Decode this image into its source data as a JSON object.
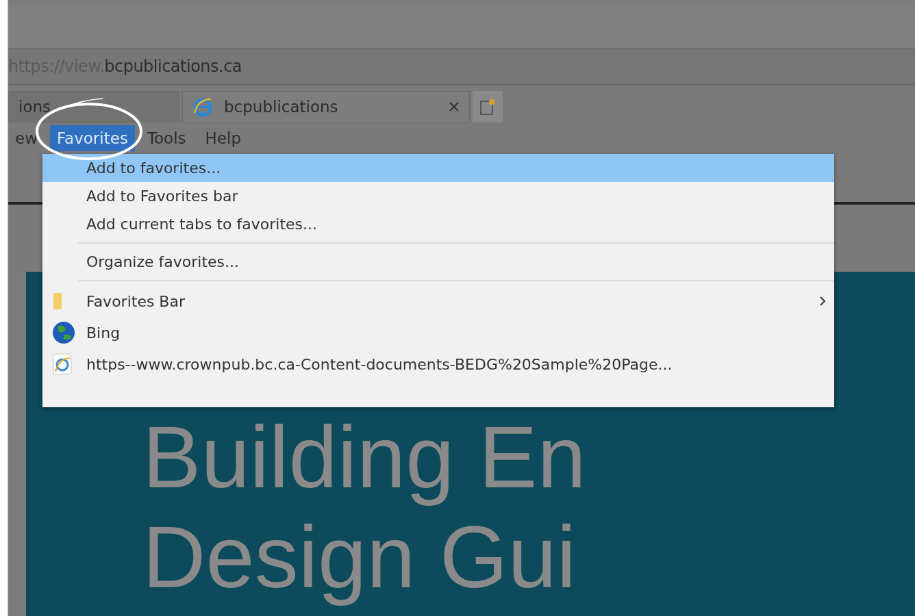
{
  "address_bar": {
    "url_prefix": "https://view.",
    "url_domain": "bcpublications.ca"
  },
  "tabs": [
    {
      "label": "ions",
      "selected": false,
      "closable": false
    },
    {
      "label": "bcpublications",
      "selected": true,
      "closable": true
    }
  ],
  "menu_bar": [
    {
      "label": "ew",
      "selected": false
    },
    {
      "label": "Favorites",
      "selected": true
    },
    {
      "label": "Tools",
      "selected": false
    },
    {
      "label": "Help",
      "selected": false
    }
  ],
  "favorites_menu": [
    {
      "kind": "command",
      "label": "Add to favorites...",
      "selected": true
    },
    {
      "kind": "command",
      "label": "Add to Favorites bar",
      "selected": false
    },
    {
      "kind": "command",
      "label": "Add current tabs to favorites...",
      "selected": false
    },
    {
      "kind": "separator"
    },
    {
      "kind": "command",
      "label": "Organize favorites...",
      "selected": false
    },
    {
      "kind": "separator"
    },
    {
      "kind": "folder",
      "label": "Favorites Bar",
      "selected": false
    },
    {
      "kind": "engine",
      "label": "Bing",
      "selected": false
    },
    {
      "kind": "link",
      "label": "https--www.crownpub.bc.ca-Content-documents-BEDG%20Sample%20Page...",
      "selected": false
    }
  ],
  "page": {
    "heading_lines": [
      "Building En",
      "Design Gui"
    ]
  }
}
